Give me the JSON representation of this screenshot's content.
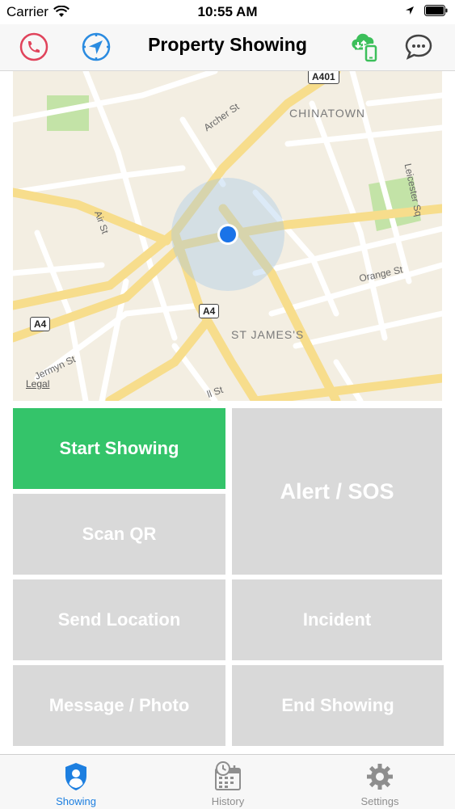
{
  "status_bar": {
    "carrier": "Carrier",
    "time": "10:55 AM"
  },
  "nav": {
    "title": "Property Showing"
  },
  "map": {
    "district_labels": [
      "CHINATOWN",
      "ST JAMES'S"
    ],
    "street_labels": [
      "Archer St",
      "Air St",
      "Leicester Sq",
      "Orange St",
      "Jermyn St",
      "ll St"
    ],
    "road_signs": [
      "A401",
      "A4",
      "A4"
    ],
    "legal": "Legal"
  },
  "buttons": {
    "start_showing": "Start Showing",
    "alert_sos": "Alert / SOS",
    "scan_qr": "Scan QR",
    "send_location": "Send Location",
    "incident": "Incident",
    "message_photo": "Message / Photo",
    "end_showing": "End Showing"
  },
  "tabs": [
    {
      "label": "Showing",
      "active": true,
      "icon": "shield-user-icon"
    },
    {
      "label": "History",
      "active": false,
      "icon": "calendar-clock-icon"
    },
    {
      "label": "Settings",
      "active": false,
      "icon": "gear-icon"
    }
  ],
  "colors": {
    "primary_green": "#34c46a",
    "button_gray": "#d9d9d9",
    "tab_active": "#1d7fe0",
    "phone_red": "#e0435b",
    "location_blue": "#2a8be0",
    "cloud_green": "#3cbf5a"
  }
}
